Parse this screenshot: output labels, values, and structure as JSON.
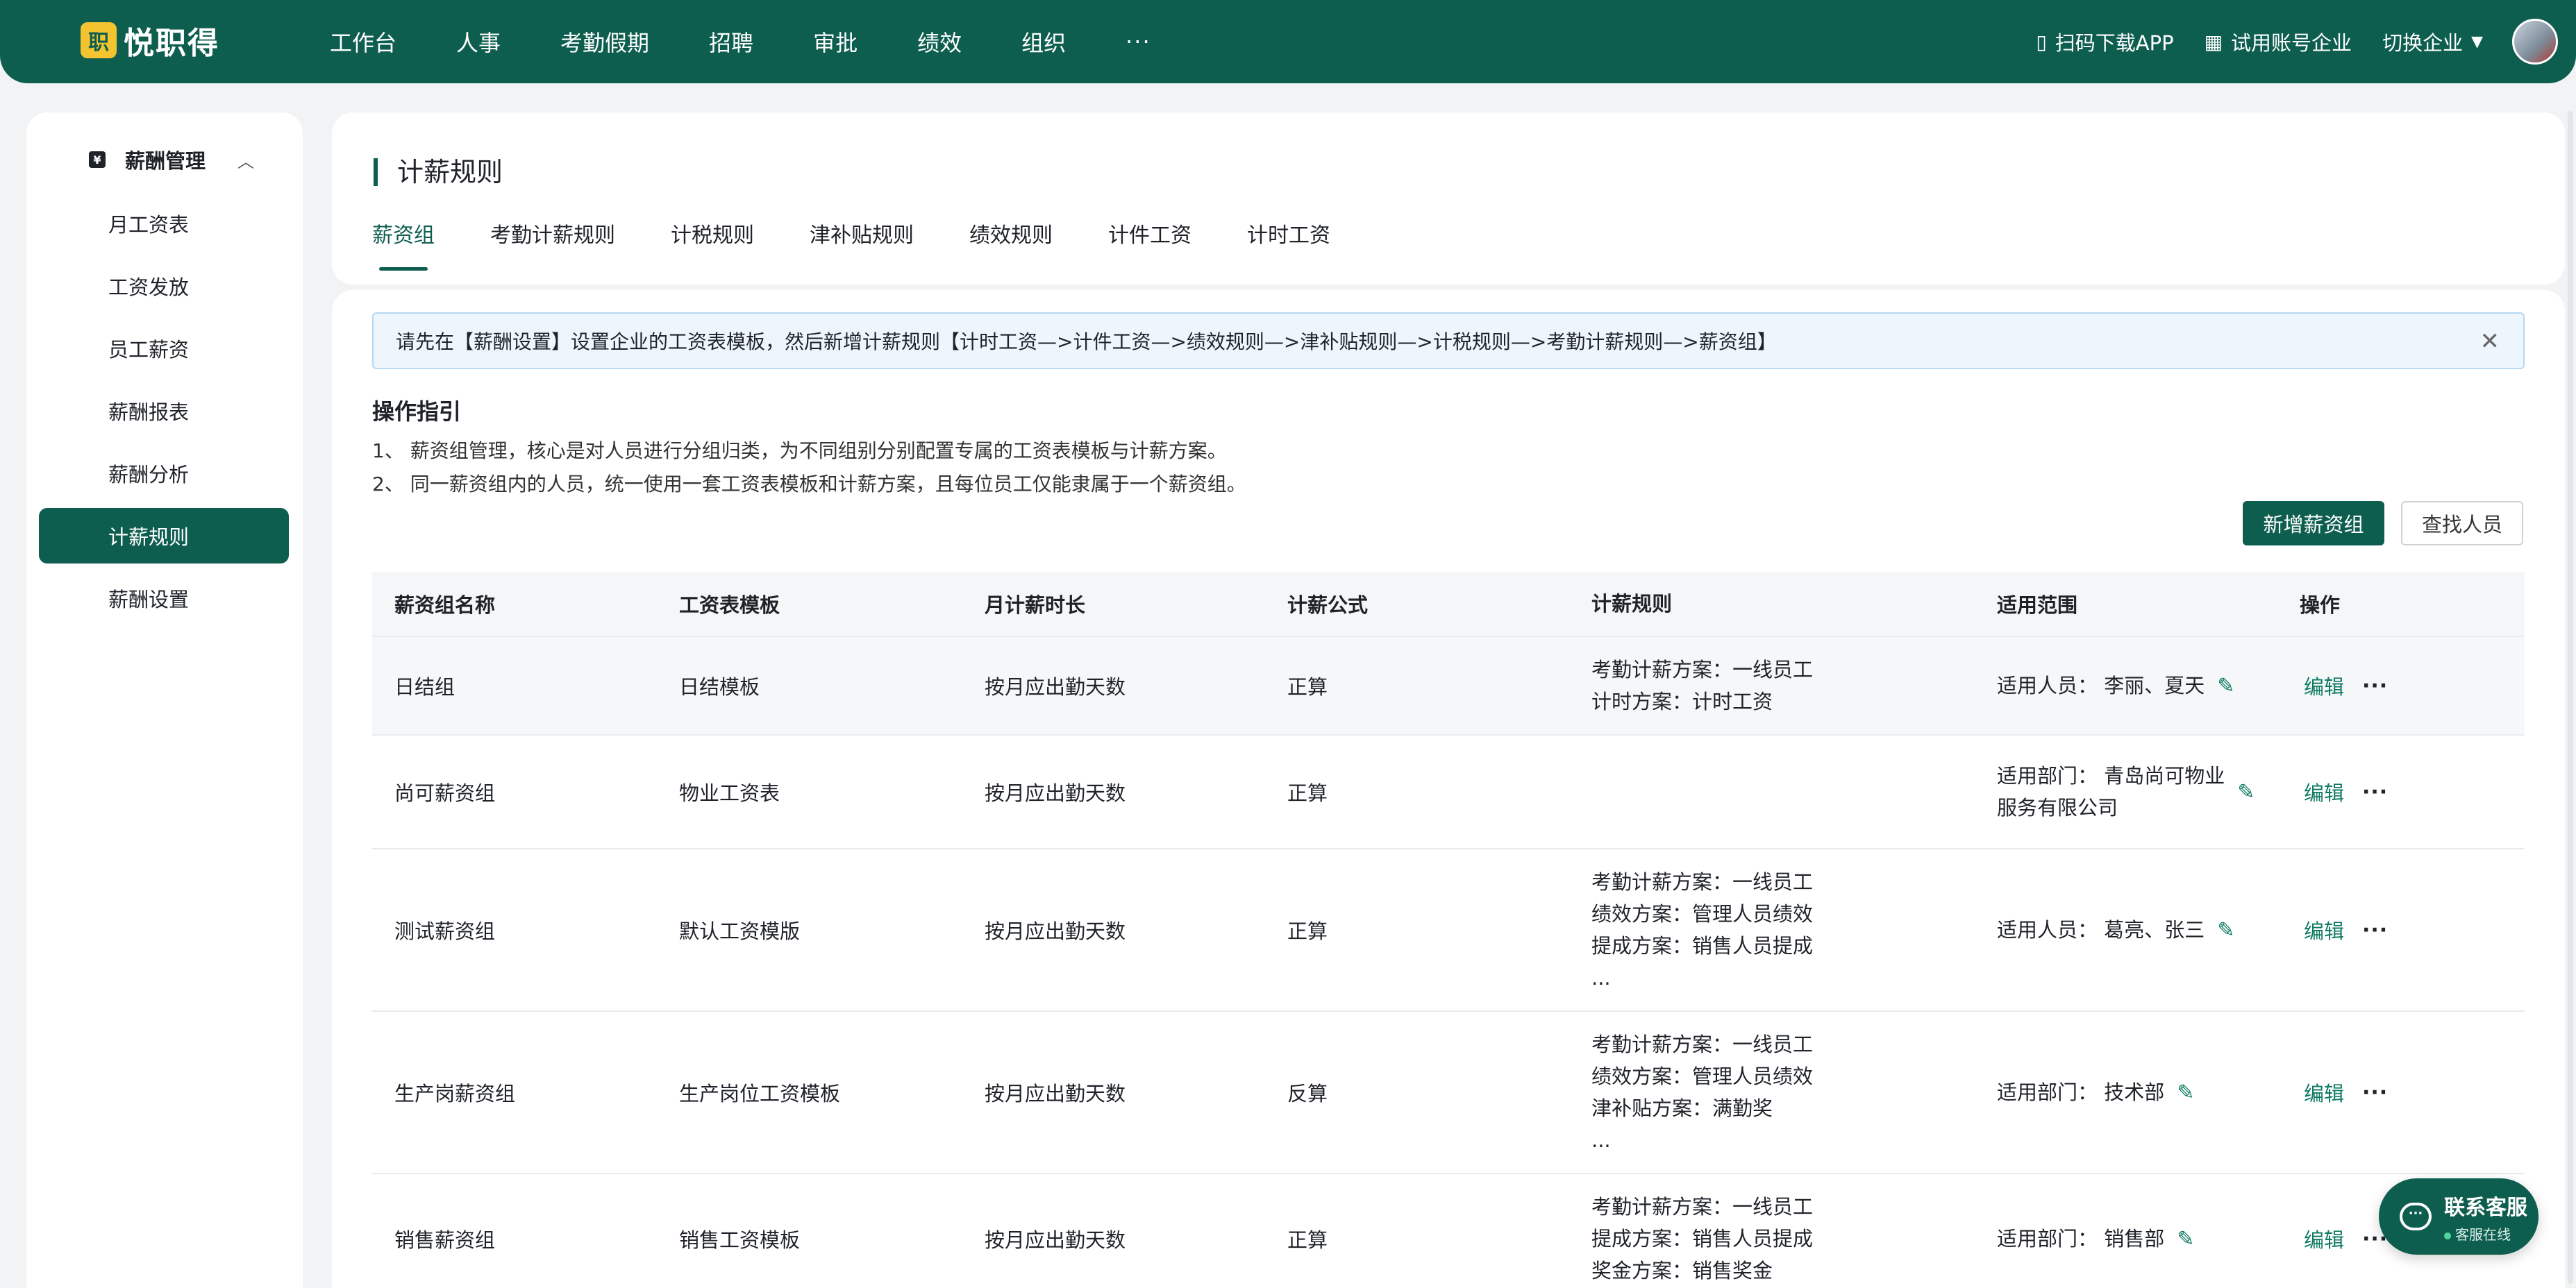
{
  "brand": {
    "logo_mark": "职",
    "name": "悦职得"
  },
  "nav": {
    "items": [
      "工作台",
      "人事",
      "考勤假期",
      "招聘",
      "审批",
      "绩效",
      "组织"
    ],
    "more": "···"
  },
  "top_right": {
    "download": "扫码下载APP",
    "trial": "试用账号企业",
    "switch": "切换企业"
  },
  "sidebar": {
    "header": "薪酬管理",
    "items": [
      "月工资表",
      "工资发放",
      "员工薪资",
      "薪酬报表",
      "薪酬分析",
      "计薪规则",
      "薪酬设置"
    ],
    "active_index": 5
  },
  "page": {
    "title": "计薪规则",
    "tabs": [
      "薪资组",
      "考勤计薪规则",
      "计税规则",
      "津补贴规则",
      "绩效规则",
      "计件工资",
      "计时工资"
    ],
    "active_tab": 0
  },
  "alert": {
    "text": "请先在【薪酬设置】设置企业的工资表模板，然后新增计薪规则【计时工资—>计件工资—>绩效规则—>津补贴规则—>计税规则—>考勤计薪规则—>薪资组】"
  },
  "guide": {
    "title": "操作指引",
    "lines": [
      "1、 薪资组管理，核心是对人员进行分组归类，为不同组别分别配置专属的工资表模板与计薪方案。",
      "2、 同一薪资组内的人员，统一使用一套工资表模板和计薪方案，且每位员工仅能隶属于一个薪资组。"
    ]
  },
  "buttons": {
    "add_group": "新增薪资组",
    "find_person": "查找人员"
  },
  "table": {
    "headers": [
      "薪资组名称",
      "工资表模板",
      "月计薪时长",
      "计薪公式",
      "计薪规则",
      "适用范围",
      "操作"
    ],
    "edit_label": "编辑",
    "more_label": "···",
    "rows": [
      {
        "name": "日结组",
        "template": "日结模板",
        "duration": "按月应出勤天数",
        "formula": "正算",
        "rules": [
          "考勤计薪方案：一线员工",
          "计时方案：计时工资"
        ],
        "scope": [
          "适用人员：  李丽、夏天"
        ]
      },
      {
        "name": "尚可薪资组",
        "template": "物业工资表",
        "duration": "按月应出勤天数",
        "formula": "正算",
        "rules": [],
        "scope": [
          "适用部门：  青岛尚可物业",
          "服务有限公司"
        ]
      },
      {
        "name": "测试薪资组",
        "template": "默认工资模版",
        "duration": "按月应出勤天数",
        "formula": "正算",
        "rules": [
          "考勤计薪方案：一线员工",
          "绩效方案：管理人员绩效",
          "提成方案：销售人员提成",
          "..."
        ],
        "scope": [
          "适用人员：  葛亮、张三"
        ]
      },
      {
        "name": "生产岗薪资组",
        "template": "生产岗位工资模板",
        "duration": "按月应出勤天数",
        "formula": "反算",
        "rules": [
          "考勤计薪方案：一线员工",
          "绩效方案：管理人员绩效",
          "津补贴方案：满勤奖",
          "..."
        ],
        "scope": [
          "适用部门：  技术部"
        ]
      },
      {
        "name": "销售薪资组",
        "template": "销售工资模板",
        "duration": "按月应出勤天数",
        "formula": "正算",
        "rules": [
          "考勤计薪方案：一线员工",
          "提成方案：销售人员提成",
          "奖金方案：销售奖金"
        ],
        "scope": [
          "适用部门：  销售部"
        ]
      }
    ]
  },
  "service": {
    "title": "联系客服",
    "status": "客服在线"
  }
}
